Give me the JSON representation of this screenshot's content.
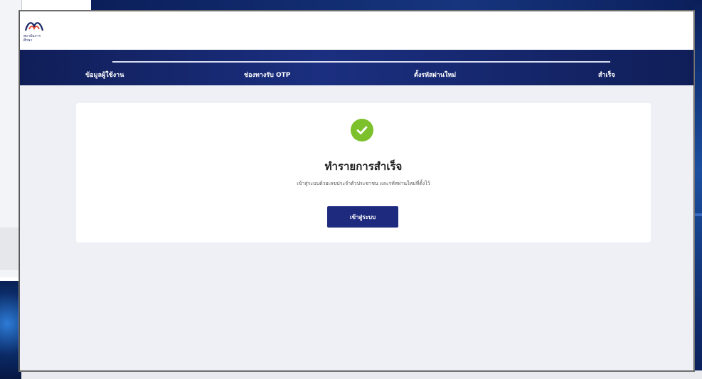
{
  "header": {
    "logo_text": "สถาบันการศึกษา",
    "logo_icon": "brand-logo-icon"
  },
  "stepper": {
    "steps": [
      {
        "label": "ข้อมูลผู้ใช้งาน"
      },
      {
        "label": "ช่องทางรับ OTP"
      },
      {
        "label": "ตั้งรหัสผ่านใหม่"
      },
      {
        "label": "สำเร็จ"
      }
    ]
  },
  "card": {
    "icon": "check-circle-icon",
    "title": "ทำรายการสำเร็จ",
    "description": "เข้าสู่ระบบด้วยเลขประจำตัวประชาชน และรหัสผ่านใหม่ที่ตั้งไว้",
    "button_label": "เข้าสู่ระบบ"
  },
  "colors": {
    "nav_bg": "#1b2f80",
    "button_bg": "#1d2a7d",
    "success": "#7cc02b",
    "page_bg": "#eef0f6"
  }
}
